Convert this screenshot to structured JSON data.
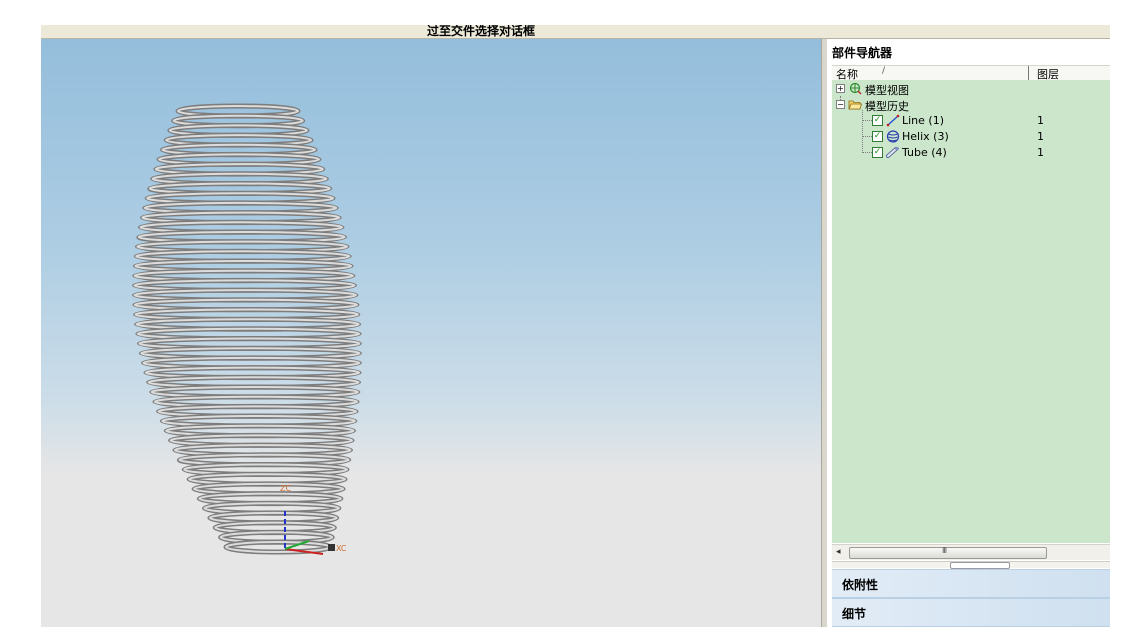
{
  "window": {
    "title": "过至交件选择对话框"
  },
  "navigator": {
    "title": "部件导航器",
    "columns": {
      "name": "名称",
      "sort_indicator": "/",
      "layer": "图层"
    },
    "tree": {
      "model_views": {
        "label": "模型视图",
        "expander": "+"
      },
      "model_history": {
        "label": "模型历史",
        "expander": "−",
        "features": [
          {
            "label": "Line (1)",
            "layer": "1",
            "icon": "line-icon",
            "checked": "✓"
          },
          {
            "label": "Helix (3)",
            "layer": "1",
            "icon": "helix-icon",
            "checked": "✓"
          },
          {
            "label": "Tube (4)",
            "layer": "1",
            "icon": "tube-icon",
            "checked": "✓"
          }
        ]
      }
    },
    "scrollbar": {
      "left_arrow": "◂",
      "grip": "III"
    }
  },
  "sections": {
    "dependencies": "依附性",
    "details": "细节"
  },
  "triad": {
    "z_label": "ZC",
    "x_label": "XC"
  },
  "colors": {
    "tree_bg": "#cbe6cb",
    "viewport_top": "#94bedc",
    "viewport_floor": "#e6e6e6",
    "helix": "#8c8c8c",
    "section_bg": "#d8e6f3"
  }
}
